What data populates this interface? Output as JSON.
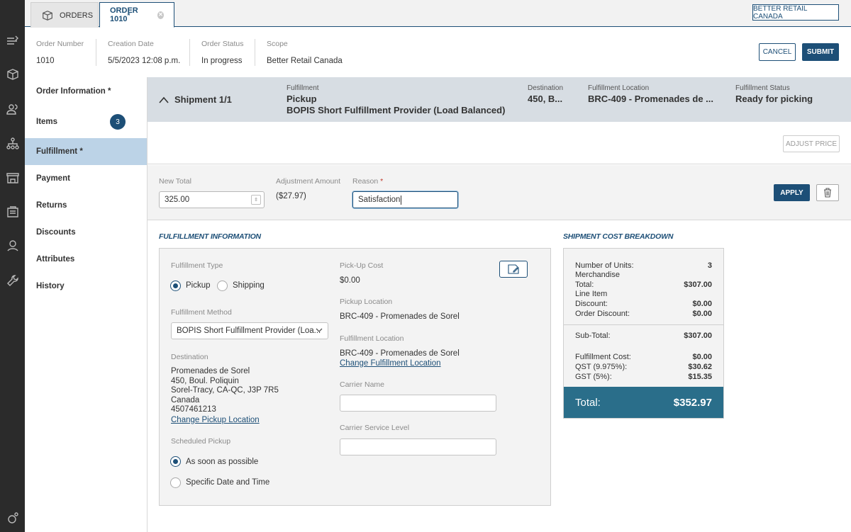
{
  "tabs": {
    "orders_label": "ORDERS",
    "order_label": "ORDER 1010",
    "order_modified_mark": "*",
    "scope_button": "BETTER RETAIL CANADA"
  },
  "order_info": {
    "number_label": "Order Number",
    "number": "1010",
    "created_label": "Creation Date",
    "created": "5/5/2023 12:08 p.m.",
    "status_label": "Order Status",
    "status": "In progress",
    "scope_label": "Scope",
    "scope": "Better Retail Canada",
    "cancel_button": "CANCEL",
    "submit_button": "SUBMIT"
  },
  "sidenav": {
    "items": [
      {
        "label": "Order Information *"
      },
      {
        "label": "Items",
        "badge": "3"
      },
      {
        "label": "Fulfillment *"
      },
      {
        "label": "Payment"
      },
      {
        "label": "Returns"
      },
      {
        "label": "Discounts"
      },
      {
        "label": "Attributes"
      },
      {
        "label": "History"
      }
    ]
  },
  "shipment": {
    "title": "Shipment 1/1",
    "fulfillment_label": "Fulfillment",
    "fulfillment_type": "Pickup",
    "fulfillment_provider": "BOPIS Short Fulfillment Provider (Load Balanced)",
    "destination_label": "Destination",
    "destination": "450, B...",
    "location_label": "Fulfillment Location",
    "location": "BRC-409 - Promenades de ...",
    "status_label": "Fulfillment Status",
    "status": "Ready for picking"
  },
  "adjust": {
    "adjust_price_button": "ADJUST PRICE",
    "new_total_label": "New Total",
    "new_total": "325.00",
    "adjustment_label": "Adjustment Amount",
    "adjustment": "($27.97)",
    "reason_label": "Reason",
    "reason_required": "*",
    "reason": "Satisfaction",
    "apply_button": "APPLY"
  },
  "fulfillment_info": {
    "section_title": "FULFILLMENT INFORMATION",
    "type_label": "Fulfillment Type",
    "type_options": [
      "Pickup",
      "Shipping"
    ],
    "method_label": "Fulfillment Method",
    "method": "BOPIS Short Fulfillment Provider (Loa...",
    "destination_label": "Destination",
    "destination_lines": [
      "Promenades de Sorel",
      "450, Boul. Poliquin",
      "Sorel-Tracy, CA-QC, J3P 7R5",
      "Canada",
      "4507461213"
    ],
    "change_pickup_link": "Change Pickup Location",
    "scheduled_label": "Scheduled Pickup",
    "scheduled_options": [
      "As soon as possible",
      "Specific Date and Time"
    ],
    "pickup_cost_label": "Pick-Up Cost",
    "pickup_cost": "$0.00",
    "pickup_location_label": "Pickup Location",
    "pickup_location": "BRC-409 - Promenades de Sorel",
    "ff_location_label": "Fulfillment Location",
    "ff_location": "BRC-409 - Promenades de Sorel",
    "change_ff_link": "Change Fulfillment Location",
    "carrier_label": "Carrier Name",
    "carrier": "",
    "service_label": "Carrier Service Level",
    "service": ""
  },
  "cost": {
    "section_title": "SHIPMENT COST BREAKDOWN",
    "units_label": "Number of Units:",
    "units": "3",
    "merch_label_1": "Merchandise",
    "merch_label_2": "Total:",
    "merch": "$307.00",
    "line_label_1": "Line Item",
    "line_label_2": "Discount:",
    "line": "$0.00",
    "order_disc_label": "Order Discount:",
    "order_disc": "$0.00",
    "subtotal_label": "Sub-Total:",
    "subtotal": "$307.00",
    "ffcost_label": "Fulfillment Cost:",
    "ffcost": "$0.00",
    "qst_label": "QST (9.975%):",
    "qst": "$30.62",
    "gst_label": "GST (5%):",
    "gst": "$15.35",
    "total_label": "Total:",
    "total": "$352.97"
  }
}
